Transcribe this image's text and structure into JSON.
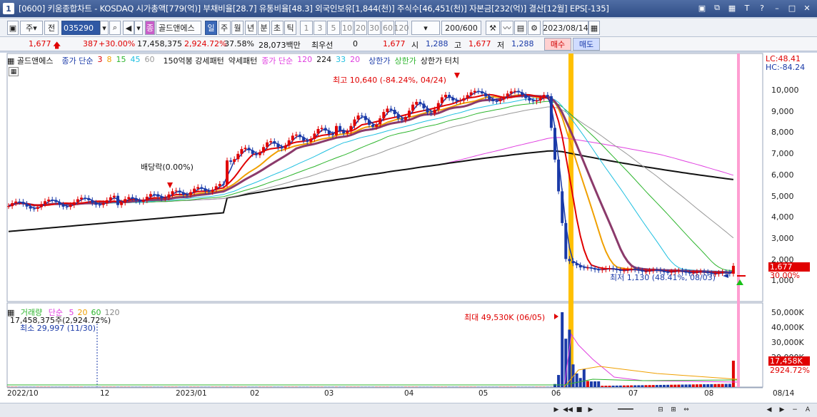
{
  "title": {
    "num": "1",
    "text": "[0600] 키움종합차트 - KOSDAQ 시가총액[779(억)] 부채비율[28.7] 유통비율[48.3] 외국인보유[1,844(천)] 주식수[46,451(천)] 자본금[232(억)] 결산[12월] EPS[-135]"
  },
  "toolbar": {
    "type": "주",
    "prev": "전",
    "code": "035290",
    "name": "골드앤에스",
    "periods": [
      "일",
      "주",
      "월",
      "년",
      "분",
      "초",
      "틱"
    ],
    "intervals": [
      "1",
      "3",
      "5",
      "10",
      "20",
      "30",
      "60",
      "120"
    ],
    "count": "200/600",
    "date": "2023/08/14"
  },
  "price": {
    "last": "1,677",
    "change": "387",
    "rate": "+30.00%",
    "volume": "17,458,375",
    "vol_rate": "2,924.72%",
    "turnover": "37.58%",
    "amount": "28,073백만",
    "pref_label": "최우선",
    "pref_val": "0",
    "cur": "1,677",
    "open_label": "시",
    "open": "1,288",
    "high_label": "고",
    "high": "1,677",
    "low_label": "저",
    "low": "1,288",
    "buy": "매수",
    "sell": "매도"
  },
  "legend": {
    "name": "골드앤에스",
    "ma_label": "종가 단순",
    "ma": [
      "3",
      "8",
      "15",
      "45",
      "60"
    ],
    "pattern1": "150억봉 강세패턴",
    "pattern2": "약세패턴",
    "ma2_label": "종가 단순",
    "ma2": [
      "120",
      "224",
      "33",
      "20"
    ],
    "upper": "상한가",
    "upper2": "상한가",
    "upper_touch": "상한가 터치"
  },
  "annotations": {
    "high": "최고 10,640 (-84.24%, 04/24)",
    "low": "최저 1,130 (48.41%, 08/03)",
    "dividend": "배당락(0.00%)",
    "vol_max": "최대 49,530K (06/05)",
    "vol_min": "최소 29,997 (11/30)",
    "vol_now": "17,458,375주(2,924.72%)",
    "lc": "LC:48.41",
    "hc": "HC:-84.24",
    "last_tag": "1,677",
    "last_pct": "30.00%",
    "vol_tag": "17,458K",
    "vol_pct": "2924.72%"
  },
  "vlegend": {
    "label": "거래량",
    "ma_label": "단순",
    "ma": [
      "5",
      "20",
      "60",
      "120"
    ]
  },
  "yaxis": [
    "10,000",
    "9,000",
    "8,000",
    "7,000",
    "6,000",
    "5,000",
    "4,000",
    "3,000",
    "2,000",
    "1,000"
  ],
  "vaxis": [
    "50,000K",
    "40,000K",
    "30,000K",
    "20,000K"
  ],
  "xaxis": [
    "2022/10",
    "12",
    "2023/01",
    "02",
    "03",
    "04",
    "05",
    "06",
    "07",
    "08",
    "08/14"
  ],
  "colors": {
    "title_bg": "#2f4d86",
    "up": "#e00000",
    "down": "#1a3aa8",
    "ma3": "#e00000",
    "ma8": "#f0a000",
    "ma15": "#2db52d",
    "ma45": "#20c0e0",
    "ma60": "#999999",
    "ma224": "#111111",
    "ma120": "#e040e0"
  }
}
